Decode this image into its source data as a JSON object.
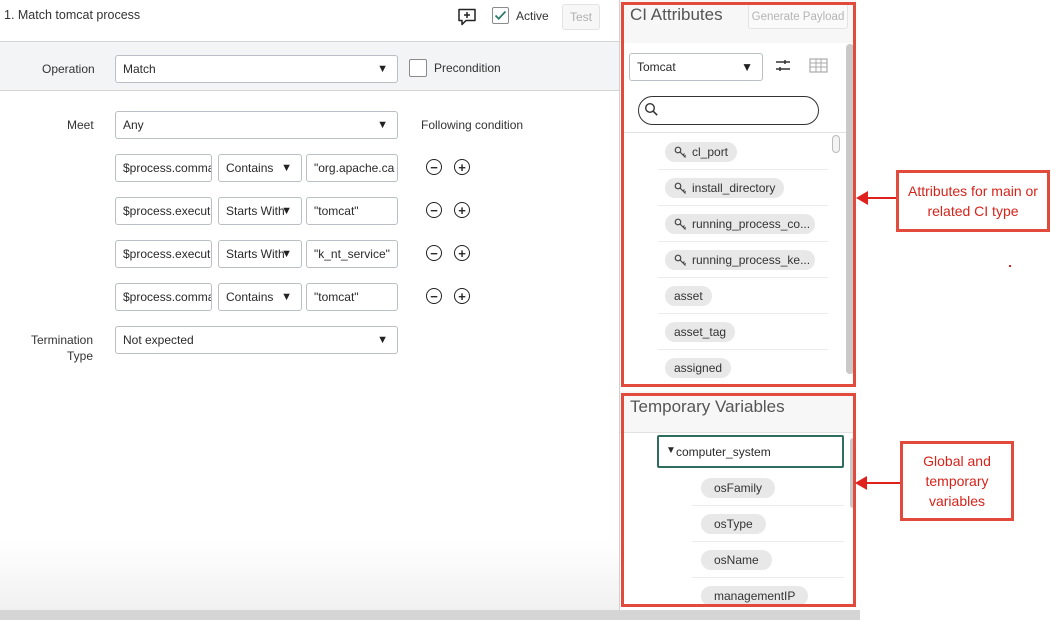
{
  "header": {
    "title": "1. Match tomcat process",
    "active_label": "Active",
    "test_label": "Test",
    "active_checked": true
  },
  "operation": {
    "label": "Operation",
    "value": "Match",
    "precondition_label": "Precondition"
  },
  "meet": {
    "label": "Meet",
    "value": "Any",
    "following_label": "Following condition"
  },
  "conditions": [
    {
      "field": "$process.comma",
      "op": "Contains",
      "value": "\"org.apache.ca"
    },
    {
      "field": "$process.execut",
      "op": "Starts With",
      "value": "\"tomcat\""
    },
    {
      "field": "$process.execut",
      "op": "Starts With",
      "value": "\"k_nt_service\""
    },
    {
      "field": "$process.comma",
      "op": "Contains",
      "value": "\"tomcat\""
    }
  ],
  "termination": {
    "label_line1": "Termination",
    "label_line2": "Type",
    "value": "Not expected"
  },
  "ci_panel": {
    "title": "CI Attributes",
    "generate_payload": "Generate Payload",
    "ci_type": "Tomcat",
    "search_placeholder": "",
    "attributes": [
      {
        "name": "cl_port",
        "key": true
      },
      {
        "name": "install_directory",
        "key": true
      },
      {
        "name": "running_process_co...",
        "key": true
      },
      {
        "name": "running_process_ke...",
        "key": true
      },
      {
        "name": "asset",
        "key": false
      },
      {
        "name": "asset_tag",
        "key": false
      },
      {
        "name": "assigned",
        "key": false
      }
    ]
  },
  "temp_panel": {
    "title": "Temporary Variables",
    "root": "computer_system",
    "children": [
      "osFamily",
      "osType",
      "osName",
      "managementIP"
    ]
  },
  "annotations": {
    "attributes_note": "Attributes for main or related CI type",
    "variables_note": "Global and temporary variables"
  },
  "colors": {
    "annotation_red": "#e24a3b",
    "active_check": "#2e7d6b",
    "selected_border": "#2f6e5e"
  }
}
